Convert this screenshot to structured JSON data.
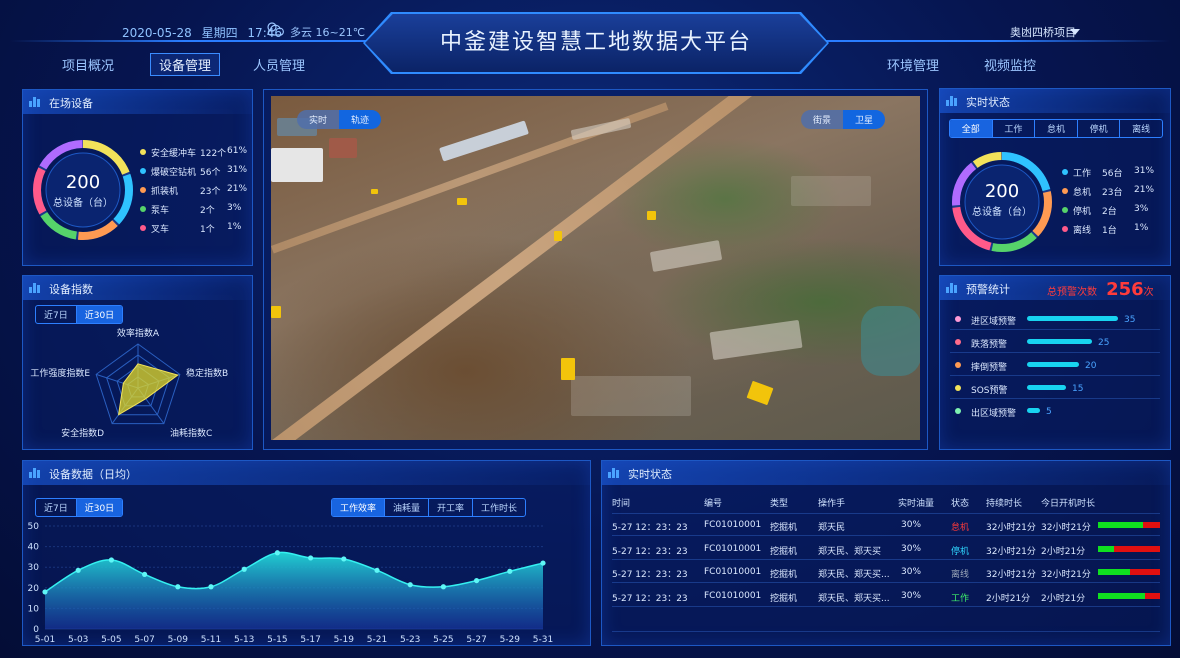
{
  "header": {
    "date": "2020-05-28",
    "weekday": "星期四",
    "time": "17:46",
    "weather": "多云 16~21℃",
    "title": "中釜建设智慧工地数据大平台",
    "project": "奥凼四桥项目"
  },
  "nav": {
    "left": [
      "项目概况",
      "设备管理",
      "人员管理"
    ],
    "right": [
      "环境管理",
      "视频监控"
    ],
    "active": "设备管理"
  },
  "onsite": {
    "title": "在场设备",
    "total": "200",
    "total_label": "总设备（台）",
    "items": [
      {
        "name": "安全缓冲车",
        "count": "122个",
        "pct": "61%",
        "color": "#f2e25a"
      },
      {
        "name": "爆破空钻机",
        "count": "56个",
        "pct": "31%",
        "color": "#2fc3ff"
      },
      {
        "name": "抓装机",
        "count": "23个",
        "pct": "21%",
        "color": "#ff9a52"
      },
      {
        "name": "泵车",
        "count": "2个",
        "pct": "3%",
        "color": "#56d36a"
      },
      {
        "name": "叉车",
        "count": "1个",
        "pct": "1%",
        "color": "#ff5a8a"
      }
    ]
  },
  "index": {
    "title": "设备指数",
    "tabs": [
      "近7日",
      "近30日"
    ],
    "active_tab": "近30日",
    "axes": [
      "效率指数A",
      "稳定指数B",
      "油耗指数C",
      "安全指数D",
      "工作强度指数E"
    ],
    "values": [
      0.55,
      0.95,
      0.3,
      0.75,
      0.35
    ]
  },
  "map": {
    "left_tabs": [
      "实时",
      "轨迹"
    ],
    "left_active": "轨迹",
    "right_tabs": [
      "街景",
      "卫星"
    ],
    "right_active": "卫星"
  },
  "status": {
    "title": "实时状态",
    "tabs": [
      "全部",
      "工作",
      "怠机",
      "停机",
      "离线"
    ],
    "active_tab": "全部",
    "total": "200",
    "total_label": "总设备（台）",
    "items": [
      {
        "name": "工作",
        "count": "56台",
        "pct": "31%",
        "color": "#2fc3ff"
      },
      {
        "name": "怠机",
        "count": "23台",
        "pct": "21%",
        "color": "#ff9a52"
      },
      {
        "name": "停机",
        "count": "2台",
        "pct": "3%",
        "color": "#56d36a"
      },
      {
        "name": "离线",
        "count": "1台",
        "pct": "1%",
        "color": "#ff5a8a"
      }
    ]
  },
  "alarm": {
    "title": "预警统计",
    "total_label": "总预警次数",
    "total_value": "256",
    "total_unit": "次",
    "items": [
      {
        "name": "进区域预警",
        "value": 35,
        "color": "#ff9ad6"
      },
      {
        "name": "跌落预警",
        "value": 25,
        "color": "#ff6b8a"
      },
      {
        "name": "摔倒预警",
        "value": 20,
        "color": "#ff9a52"
      },
      {
        "name": "SOS预警",
        "value": 15,
        "color": "#f2e25a"
      },
      {
        "name": "出区域预警",
        "value": 5,
        "color": "#7ef2b0"
      }
    ]
  },
  "daily": {
    "title": "设备数据（日均）",
    "tabs": [
      "近7日",
      "近30日"
    ],
    "active_tab": "近30日",
    "metric_tabs": [
      "工作效率",
      "油耗量",
      "开工率",
      "工作时长"
    ],
    "active_metric": "工作效率"
  },
  "chart_data": {
    "type": "area",
    "x": [
      "5-01",
      "5-03",
      "5-05",
      "5-07",
      "5-09",
      "5-11",
      "5-13",
      "5-15",
      "5-17",
      "5-19",
      "5-21",
      "5-23",
      "5-25",
      "5-27",
      "5-29",
      "5-31"
    ],
    "values": [
      18,
      28.5,
      33.5,
      26.5,
      20.5,
      20.5,
      29,
      37,
      34.5,
      34,
      28.5,
      21.5,
      20.5,
      23.5,
      28,
      32
    ],
    "y_ticks": [
      0,
      10,
      20,
      30,
      40,
      50
    ],
    "ylim": [
      0,
      50
    ],
    "grid": true
  },
  "realtime": {
    "title": "实时状态",
    "columns": [
      "时间",
      "编号",
      "类型",
      "操作手",
      "实时油量",
      "状态",
      "持续时长",
      "今日开机时长"
    ],
    "rows": [
      {
        "time": "5-27  12：23：23",
        "id": "FC01010001",
        "type": "挖掘机",
        "operator": "郑天民",
        "fuel": "30%",
        "status": "怠机",
        "status_color": "#ff3a3a",
        "duration": "32小时21分",
        "today": "32小时21分",
        "ratio": 0.73
      },
      {
        "time": "5-27  12：23：23",
        "id": "FC01010001",
        "type": "挖掘机",
        "operator": "郑天民、郑天买",
        "fuel": "30%",
        "status": "停机",
        "status_color": "#2fd8ff",
        "duration": "32小时21分",
        "today": "2小时21分",
        "ratio": 0.25
      },
      {
        "time": "5-27  12：23：23",
        "id": "FC01010001",
        "type": "挖掘机",
        "operator": "郑天民、郑天买...",
        "fuel": "30%",
        "status": "离线",
        "status_color": "#9aa6b8",
        "duration": "32小时21分",
        "today": "32小时21分",
        "ratio": 0.52
      },
      {
        "time": "5-27  12：23：23",
        "id": "FC01010001",
        "type": "挖掘机",
        "operator": "郑天民、郑天买...",
        "fuel": "30%",
        "status": "工作",
        "status_color": "#3ef06a",
        "duration": "2小时21分",
        "today": "2小时21分",
        "ratio": 0.75
      }
    ]
  }
}
